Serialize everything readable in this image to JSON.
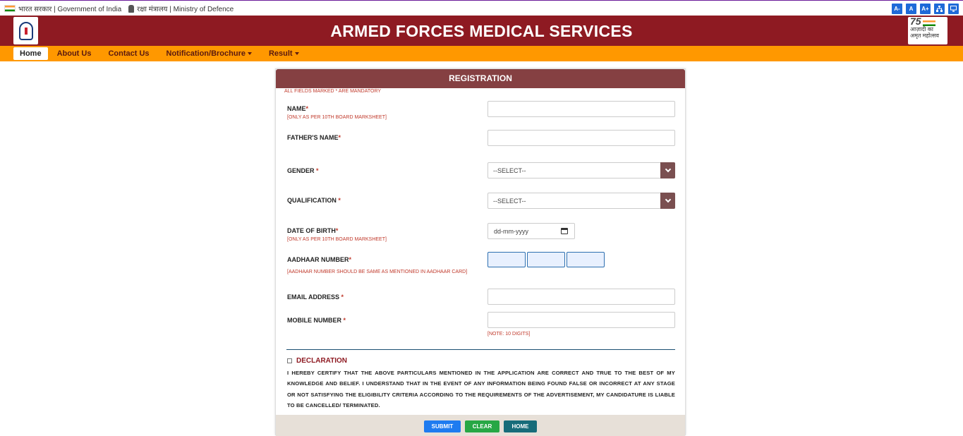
{
  "gov": {
    "india_label": "भारत सरकार | Government of India",
    "defence_label": "रक्षा मंत्रालय | Ministry of Defence",
    "accessibility": [
      "A-",
      "A",
      "A+",
      "",
      ""
    ]
  },
  "header": {
    "title": "ARMED FORCES MEDICAL SERVICES",
    "logo_right_line1": "आज़ादी का",
    "logo_right_line2": "अमृत महोत्सव",
    "logo_right_number": "75"
  },
  "nav": {
    "items": [
      {
        "label": "Home",
        "active": true,
        "dropdown": false
      },
      {
        "label": "About Us",
        "active": false,
        "dropdown": false
      },
      {
        "label": "Contact Us",
        "active": false,
        "dropdown": false
      },
      {
        "label": "Notification/Brochure",
        "active": false,
        "dropdown": true
      },
      {
        "label": "Result",
        "active": false,
        "dropdown": true
      }
    ]
  },
  "form": {
    "title": "REGISTRATION",
    "mandatory_note": "ALL FIELDS MARKED * ARE MANDATORY",
    "required_mark": "*",
    "name_label": "NAME",
    "name_hint": "[ONLY AS PER 10TH BOARD MARKSHEET]",
    "father_label": "FATHER'S NAME",
    "gender_label": "GENDER",
    "gender_value": "--SELECT--",
    "qualification_label": "QUALIFICATION",
    "qualification_value": "--SELECT--",
    "dob_label": "DATE OF BIRTH",
    "dob_hint": "[ONLY AS PER 10TH BOARD MARKSHEET]",
    "dob_placeholder": "dd-mm-yyyy",
    "aadhaar_label": "AADHAAR NUMBER",
    "aadhaar_hint": "[AADHAAR NUMBER SHOULD BE SAME AS MENTIONED IN AADHAAR CARD]",
    "email_label": "EMAIL ADDRESS",
    "mobile_label": "MOBILE NUMBER",
    "mobile_note": "[NOTE: 10 DIGITS]",
    "declaration_title": "DECLARATION",
    "declaration_text": "I HEREBY CERTIFY THAT THE ABOVE PARTICULARS MENTIONED IN THE APPLICATION ARE CORRECT AND TRUE TO THE BEST OF MY KNOWLEDGE AND BELIEF. I UNDERSTAND THAT IN THE EVENT OF ANY INFORMATION BEING FOUND FALSE OR INCORRECT AT ANY STAGE OR NOT SATISFYING THE ELIGIBILITY CRITERIA ACCORDING TO THE REQUIREMENTS OF THE ADVERTISEMENT, MY CANDIDATURE IS LIABLE TO BE CANCELLED/ TERMINATED.",
    "submit_label": "SUBMIT",
    "clear_label": "CLEAR",
    "home_label": "HOME"
  },
  "colors": {
    "header_bg": "#8e1a22",
    "nav_bg": "#ff9800",
    "card_head": "#854042",
    "required": "#c0392b",
    "submit": "#1e7bf0",
    "clear": "#27a745",
    "home": "#176c7a"
  }
}
